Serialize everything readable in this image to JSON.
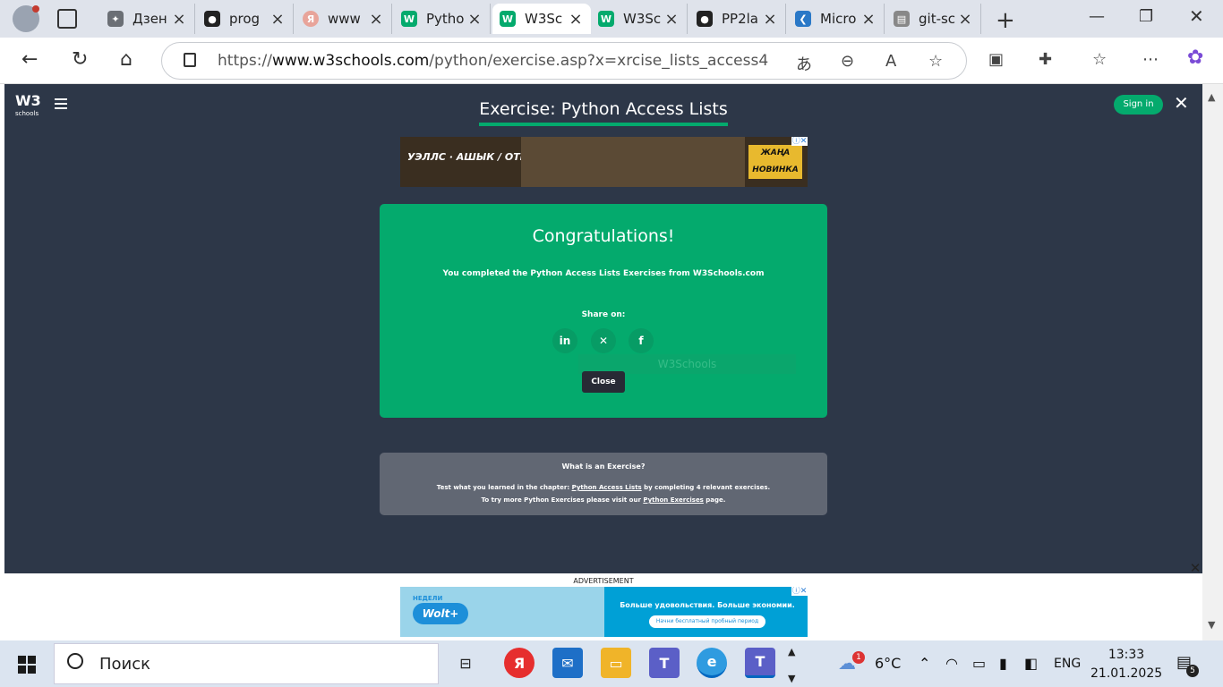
{
  "browser": {
    "tabs": [
      {
        "label": "Дзен",
        "icon": "sparkle-icon",
        "color": "#6b6f75"
      },
      {
        "label": "prog",
        "icon": "github-icon",
        "color": "#222222"
      },
      {
        "label": "www",
        "icon": "yandex-icon",
        "color": "#e8a49a"
      },
      {
        "label": "Pytho",
        "icon": "w3schools-icon",
        "color": "#04aa6d"
      },
      {
        "label": "W3Sc",
        "icon": "w3schools-icon",
        "color": "#04aa6d"
      },
      {
        "label": "W3Sc",
        "icon": "w3schools-icon",
        "color": "#04aa6d"
      },
      {
        "label": "PP2la",
        "icon": "github-icon",
        "color": "#222222"
      },
      {
        "label": "Micro",
        "icon": "vscode-icon",
        "color": "#2a78c7"
      },
      {
        "label": "git-sc",
        "icon": "document-icon",
        "color": "#888888"
      }
    ],
    "active_tab_index": 4,
    "url_prefix": "https://",
    "url_host": "www.w3schools.com",
    "url_path": "/python/exercise.asp?x=xrcise_lists_access4"
  },
  "page": {
    "logo": "W3",
    "logo_sub": "schools",
    "title": "Exercise: Python Access Lists",
    "sign_in": "Sign in",
    "ad_top_left": "УЭЛЛС · АШЫК / ОТКРЫТ ПЕРЕРЫВА",
    "ad_top_right_1": "ЖАҢА",
    "ad_top_right_2": "НОВИНКА",
    "congrats_title": "Congratulations!",
    "congrats_msg": "You completed the Python Access Lists Exercises from W3Schools.com",
    "share_on": "Share on:",
    "ghost_text": "W3Schools",
    "close_btn": "Close",
    "info_heading": "What is an Exercise?",
    "info_line1_pre": "Test what you learned in the chapter: ",
    "info_line1_link": "Python Access Lists",
    "info_line1_post": " by completing 4 relevant exercises.",
    "info_line2_pre": "To try more Python Exercises please visit our ",
    "info_line2_link": "Python Exercises",
    "info_line2_post": " page.",
    "ad_label": "ADVERTISEMENT",
    "ad_bottom_badge": "НЕДЕЛИ",
    "ad_bottom_brand": "Wolt+",
    "ad_bottom_headline": "Больше удовольствия. Больше экономии.",
    "ad_bottom_cta": "Начни бесплатный пробный период"
  },
  "taskbar": {
    "search": "Поиск",
    "weather": "6°C",
    "weather_badge": "1",
    "lang": "ENG",
    "time": "13:33",
    "date": "21.01.2025",
    "notif_count": "5"
  }
}
